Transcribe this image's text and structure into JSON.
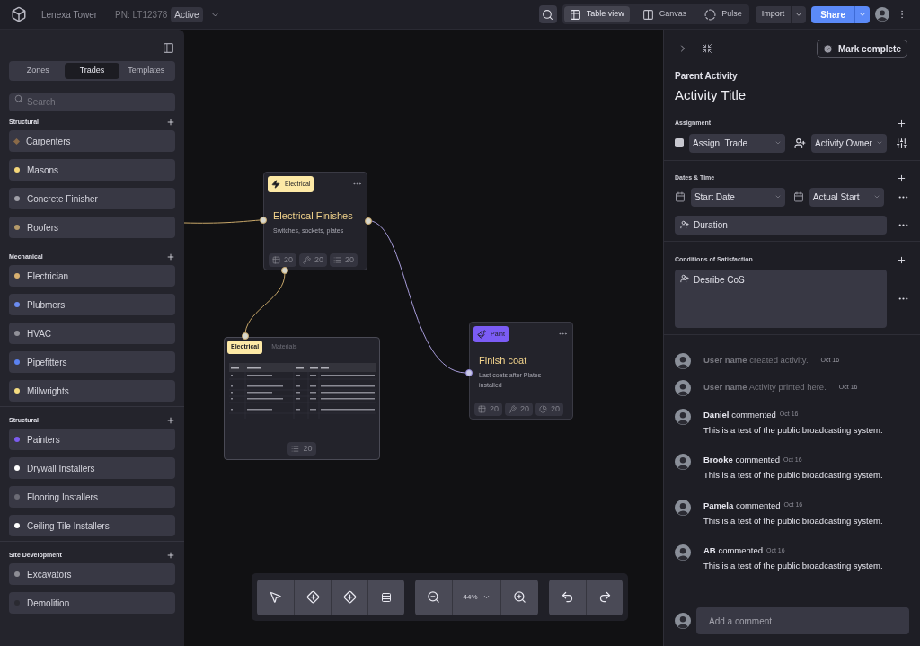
{
  "header": {
    "project": "Lenexa Tower",
    "pn": "PN: LT12378",
    "status": "Active"
  },
  "views": [
    {
      "label": "Table view",
      "selected": true
    },
    {
      "label": "Canvas",
      "selected": false
    },
    {
      "label": "Pulse",
      "selected": false
    }
  ],
  "actions": {
    "import": "Import",
    "share": "Share"
  },
  "sidebar": {
    "tabs": [
      {
        "label": "Zones",
        "selected": false
      },
      {
        "label": "Trades",
        "selected": true
      },
      {
        "label": "Templates",
        "selected": false
      }
    ],
    "search_placeholder": "Search",
    "groups": [
      {
        "title": "Structural",
        "items": [
          {
            "label": "Carpenters",
            "color": "#8a6a48",
            "kind": "diamond"
          },
          {
            "label": "Masons",
            "color": "#f5d77a",
            "kind": "dot"
          },
          {
            "label": "Concrete Finisher",
            "color": "#a0a0a8",
            "kind": "dot"
          },
          {
            "label": "Roofers",
            "color": "#b59a6a",
            "kind": "dot"
          }
        ]
      },
      {
        "title": "Mechanical",
        "items": [
          {
            "label": "Electrician",
            "color": "#d8b070",
            "kind": "dot"
          },
          {
            "label": "Plubmers",
            "color": "#6b8cf0",
            "kind": "dot"
          },
          {
            "label": "HVAC",
            "color": "#909098",
            "kind": "dot"
          },
          {
            "label": "Pipefitters",
            "color": "#5b82f0",
            "kind": "dot"
          },
          {
            "label": "Millwrights",
            "color": "#f5dc80",
            "kind": "dot"
          }
        ]
      },
      {
        "title": "Structural",
        "items": [
          {
            "label": "Painters",
            "color": "#7c5cf0",
            "kind": "dot"
          },
          {
            "label": "Drywall Installers",
            "color": "#ffffff",
            "kind": "dot"
          },
          {
            "label": "Flooring Installers",
            "color": "#6b6b75",
            "kind": "dot"
          },
          {
            "label": "Ceiling Tile Installers",
            "color": "#ffffff",
            "kind": "dot"
          }
        ]
      },
      {
        "title": "Site Development",
        "items": [
          {
            "label": "Excavators",
            "color": "#8d8d95",
            "kind": "dot"
          },
          {
            "label": "Demolition",
            "color": "#2a2a31",
            "kind": "dot"
          }
        ]
      }
    ]
  },
  "canvas": {
    "nodes": [
      {
        "kind": "activity",
        "badge": {
          "label": "Electrical",
          "color": "#fde9a6"
        },
        "title": "Electrical Finishes",
        "subtitle": "Switches, sockets, plates",
        "stats": [
          "20",
          "20",
          "20"
        ]
      },
      {
        "kind": "table",
        "tabs": [
          {
            "label": "Electrical",
            "selected": true
          },
          {
            "label": "Materials",
            "selected": false
          }
        ],
        "stats": [
          "20"
        ]
      },
      {
        "kind": "activity",
        "badge": {
          "label": "Paint",
          "color": "#7b5cf5"
        },
        "title": "Finish coat",
        "subtitle": "Last coats after Plates installed",
        "stats": [
          "20",
          "20",
          "20"
        ]
      }
    ]
  },
  "toolbar": {
    "zoom": "44%"
  },
  "panel": {
    "mark_complete": "Mark complete",
    "parent": "Parent Activity",
    "title": "Activity Title",
    "assignment": {
      "heading": "Assignment",
      "trade": "Assign  Trade",
      "owner": "Activity Owner"
    },
    "dates": {
      "heading": "Dates & Time",
      "start": "Start Date",
      "actual": "Actual Start",
      "duration": "Duration"
    },
    "cos": {
      "heading": "Conditions of Satisfaction",
      "placeholder": "Desribe CoS"
    },
    "feed": [
      {
        "kind": "event",
        "user": "User name",
        "text": "created activity.",
        "date": "Oct 16"
      },
      {
        "kind": "event",
        "user": "User name",
        "text": "Activity printed here.",
        "date": "Oct 16"
      },
      {
        "kind": "comment",
        "user": "Daniel",
        "text": "commented",
        "date": "Oct 16",
        "body": "This is a test of the public broadcasting system."
      },
      {
        "kind": "comment",
        "user": "Brooke",
        "text": "commented",
        "date": "Oct 16",
        "body": "This is a test of the public broadcasting system."
      },
      {
        "kind": "comment",
        "user": "Pamela",
        "text": "commented",
        "date": "Oct 16",
        "body": "This is a test of the public broadcasting system."
      },
      {
        "kind": "comment",
        "user": "AB",
        "text": "commented",
        "date": "Oct 16",
        "body": "This is a test of the public broadcasting system."
      }
    ],
    "comment_placeholder": "Add a comment"
  }
}
